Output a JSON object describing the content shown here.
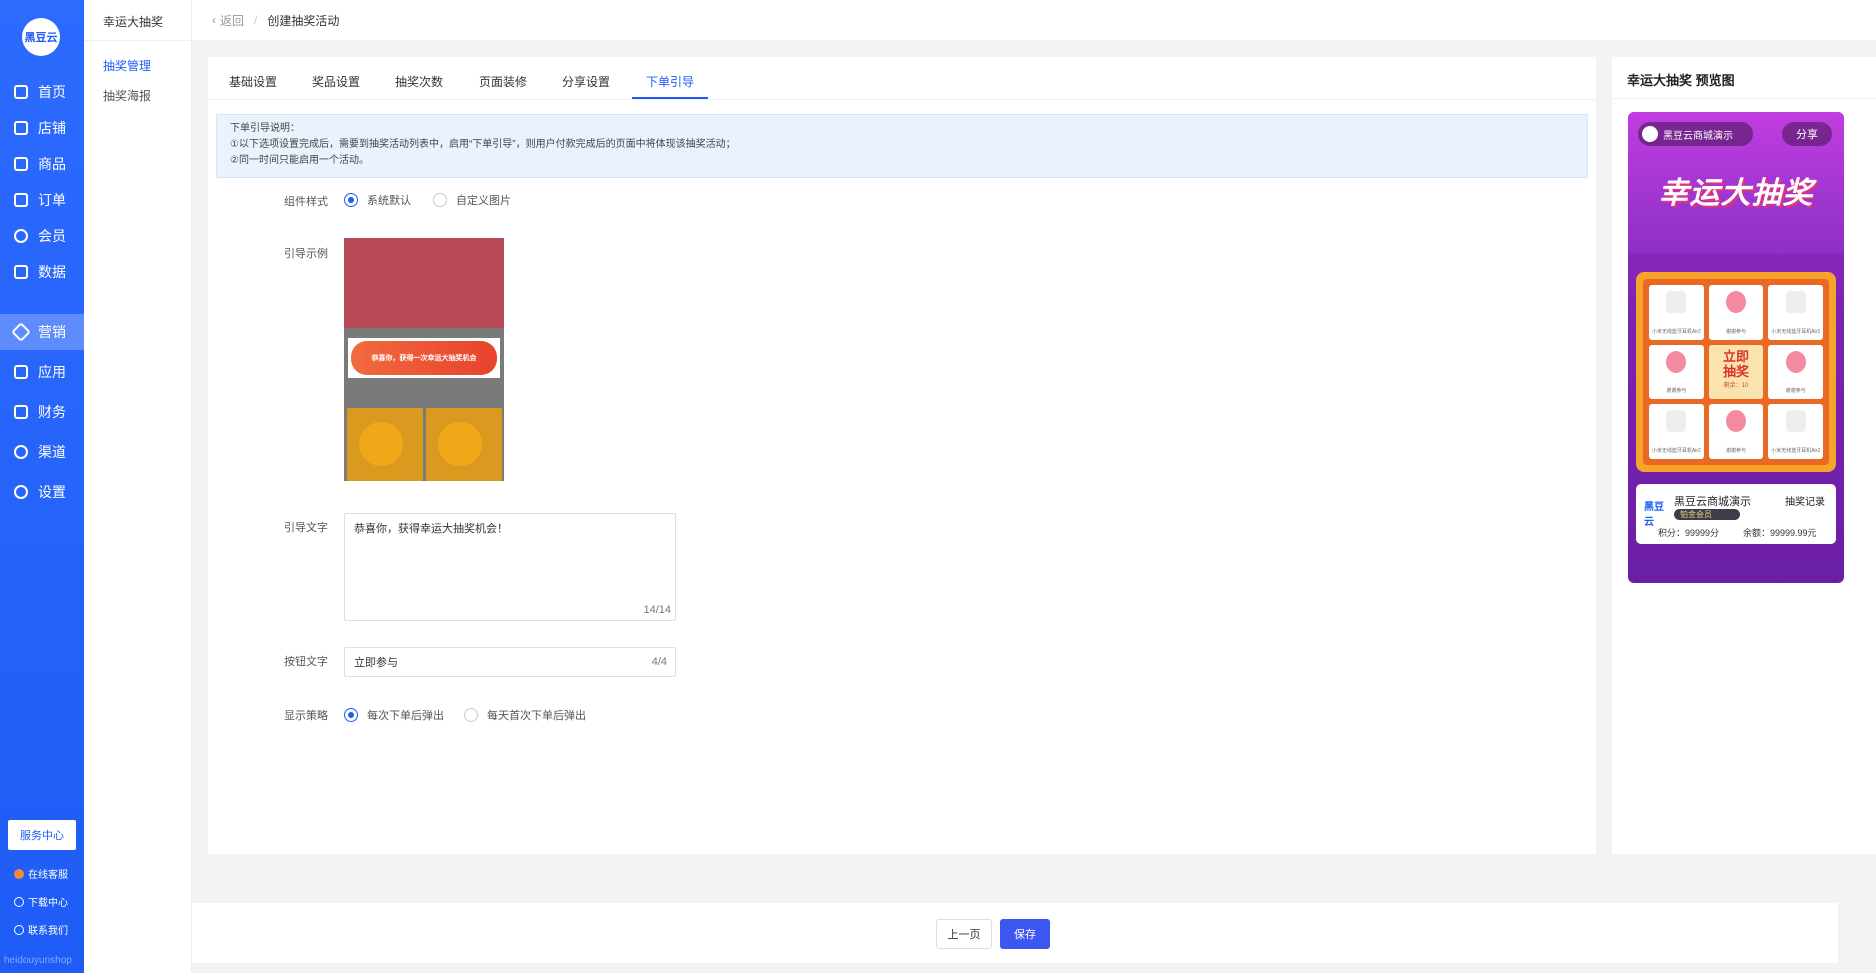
{
  "sidebar": {
    "logo_text": "黑豆云",
    "items": [
      {
        "label": "首页",
        "icon": "home-icon"
      },
      {
        "label": "店铺",
        "icon": "store-icon"
      },
      {
        "label": "商品",
        "icon": "goods-icon"
      },
      {
        "label": "订单",
        "icon": "order-icon"
      },
      {
        "label": "会员",
        "icon": "user-icon"
      },
      {
        "label": "数据",
        "icon": "chart-icon"
      },
      {
        "label": "营销",
        "icon": "tag-icon"
      },
      {
        "label": "应用",
        "icon": "app-icon"
      },
      {
        "label": "财务",
        "icon": "finance-icon"
      },
      {
        "label": "渠道",
        "icon": "channel-icon"
      },
      {
        "label": "设置",
        "icon": "gear-icon"
      }
    ],
    "active_index": 6,
    "service_center": "服务中心",
    "links": [
      "在线客服",
      "下载中心",
      "联系我们"
    ],
    "brand": "heidouyunshop"
  },
  "subnav": {
    "title": "幸运大抽奖",
    "items": [
      "抽奖管理",
      "抽奖海报"
    ]
  },
  "header": {
    "back": "返回",
    "crumb": "创建抽奖活动"
  },
  "tabs": [
    "基础设置",
    "奖品设置",
    "抽奖次数",
    "页面装修",
    "分享设置",
    "下单引导"
  ],
  "active_tab": "下单引导",
  "notice": {
    "title": "下单引导说明：",
    "line1": "①以下选项设置完成后，需要到抽奖活动列表中，启用“下单引导”，则用户付款完成后的页面中将体现该抽奖活动；",
    "line2": "②同一时间只能启用一个活动。"
  },
  "form": {
    "style_label": "组件样式",
    "style_options": [
      "系统默认",
      "自定义图片"
    ],
    "style_selected": "系统默认",
    "example_label": "引导示例",
    "example_banner": "恭喜你，获得一次幸运大抽奖机会",
    "guide_text_label": "引导文字",
    "guide_text_value": "恭喜你，获得幸运大抽奖机会！",
    "guide_text_count": "14/14",
    "button_text_label": "按钮文字",
    "button_text_value": "立即参与",
    "button_text_count": "4/4",
    "strategy_label": "显示策略",
    "strategy_options": [
      "每次下单后弹出",
      "每天首次下单后弹出"
    ],
    "strategy_selected": "每次下单后弹出"
  },
  "preview": {
    "title": "幸运大抽奖 预览图",
    "shop_name": "黑豆云商城演示",
    "share": "分享",
    "big_title": "幸运大抽奖",
    "cells": [
      "小米无线蓝牙耳机Air2",
      "谢谢参与",
      "小米无线蓝牙耳机Air2",
      "谢谢参与",
      "",
      "谢谢参与",
      "小米无线蓝牙耳机Air2",
      "谢谢参与",
      "小米无线蓝牙耳机Air2"
    ],
    "center_line1": "立即",
    "center_line2": "抽奖",
    "center_sub": "剩余：10",
    "user_logo": "黑豆云",
    "user_name": "黑豆云商城演示",
    "user_badge": "铂金会员",
    "record": "抽奖记录",
    "points": "积分：99999分",
    "balance": "余额：99999.99元"
  },
  "footer": {
    "prev": "上一页",
    "save": "保存"
  },
  "colors": {
    "primary": "#1e5cf5",
    "sidebar": "#2d6bff",
    "notice_bg": "#eaf2fd",
    "save_button": "#3b57f0"
  }
}
